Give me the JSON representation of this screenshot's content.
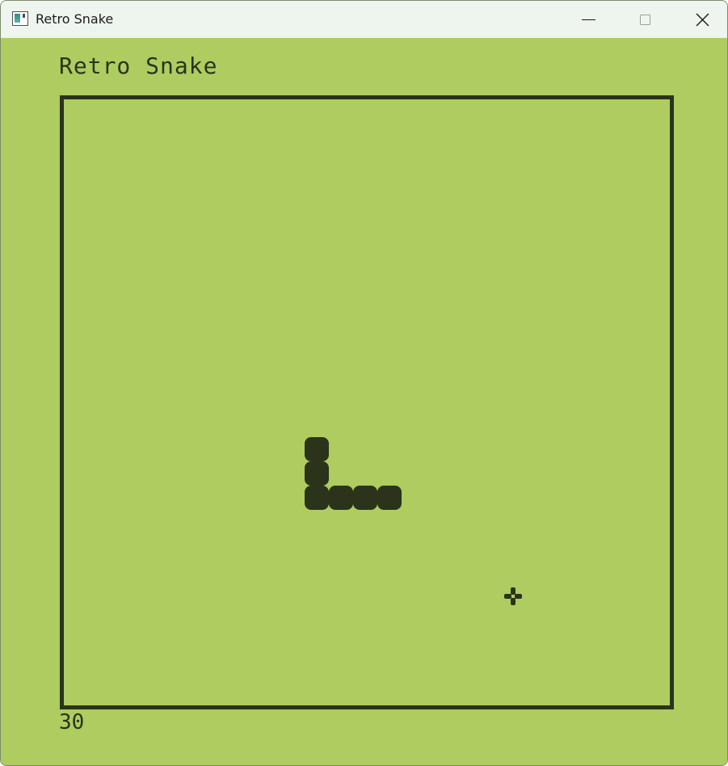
{
  "window": {
    "title": "Retro Snake",
    "icon": "app-window-icon",
    "controls": [
      "minimize-icon",
      "maximize-icon",
      "close-icon"
    ]
  },
  "game": {
    "title": "Retro Snake",
    "score": "30",
    "snake_segments": [
      {
        "col": 10,
        "row": 14
      },
      {
        "col": 10,
        "row": 15
      },
      {
        "col": 10,
        "row": 16
      },
      {
        "col": 11,
        "row": 16
      },
      {
        "col": 12,
        "row": 16
      },
      {
        "col": 13,
        "row": 16
      }
    ],
    "food": {
      "col": 18,
      "row": 20,
      "icon": "food-plus-icon"
    }
  },
  "colors": {
    "background": "#aecc60",
    "dark": "#2b331a",
    "titlebar": "#eef4ee"
  }
}
